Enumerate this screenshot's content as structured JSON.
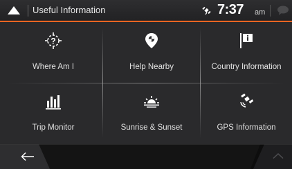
{
  "header": {
    "title": "Useful Information",
    "time": "7:37",
    "ampm": "am",
    "accent_color": "#f26522"
  },
  "menu": [
    {
      "label": "Where Am I",
      "icon": "where-am-i-icon"
    },
    {
      "label": "Help Nearby",
      "icon": "help-nearby-icon"
    },
    {
      "label": "Country Information",
      "icon": "country-information-icon"
    },
    {
      "label": "Trip Monitor",
      "icon": "trip-monitor-icon"
    },
    {
      "label": "Sunrise & Sunset",
      "icon": "sunrise-sunset-icon"
    },
    {
      "label": "GPS Information",
      "icon": "gps-information-icon"
    }
  ],
  "footer": {
    "back_icon": "back-arrow-icon",
    "scroll_up_icon": "chevron-up-icon"
  }
}
